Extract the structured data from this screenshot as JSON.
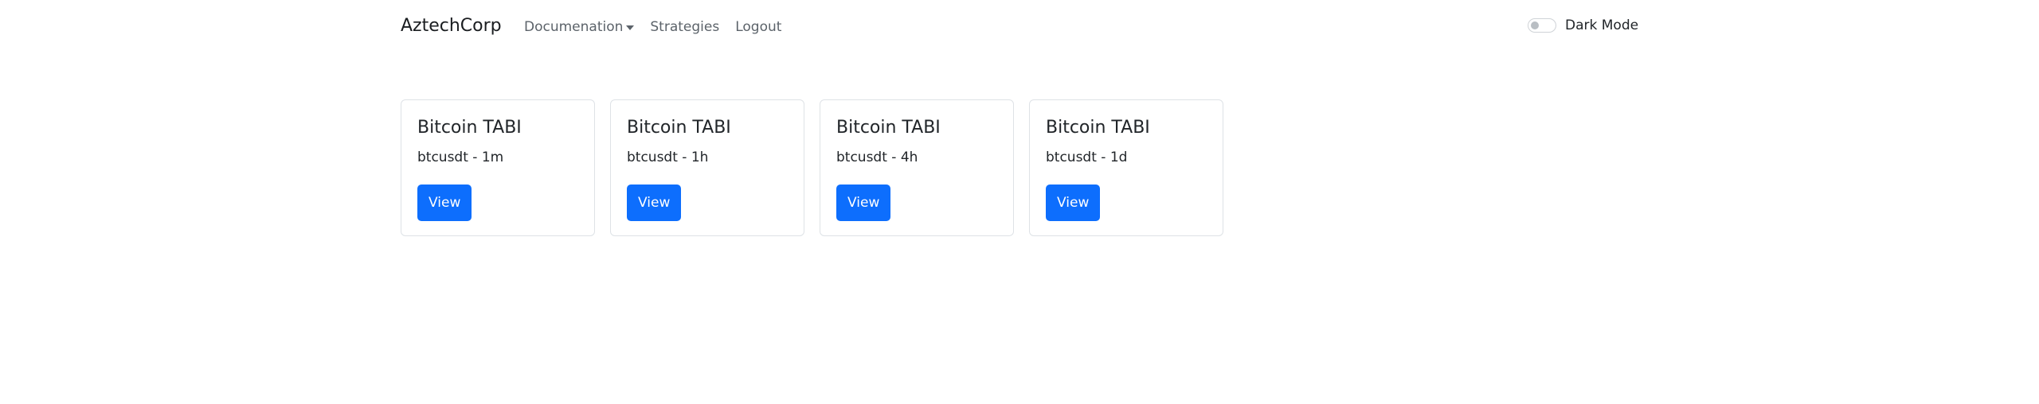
{
  "navbar": {
    "brand": "AztechCorp",
    "links": [
      {
        "label": "Documenation",
        "dropdown": true
      },
      {
        "label": "Strategies"
      },
      {
        "label": "Logout"
      }
    ],
    "dark_mode": {
      "label": "Dark Mode",
      "enabled": false
    }
  },
  "cards": [
    {
      "title": "Bitcoin TABI",
      "subtitle": "btcusdt - 1m",
      "button": "View"
    },
    {
      "title": "Bitcoin TABI",
      "subtitle": "btcusdt - 1h",
      "button": "View"
    },
    {
      "title": "Bitcoin TABI",
      "subtitle": "btcusdt - 4h",
      "button": "View"
    },
    {
      "title": "Bitcoin TABI",
      "subtitle": "btcusdt - 1d",
      "button": "View"
    }
  ],
  "colors": {
    "primary": "#0d6efd",
    "nav_link": "#5c636a",
    "card_border": "#dee2e6"
  }
}
